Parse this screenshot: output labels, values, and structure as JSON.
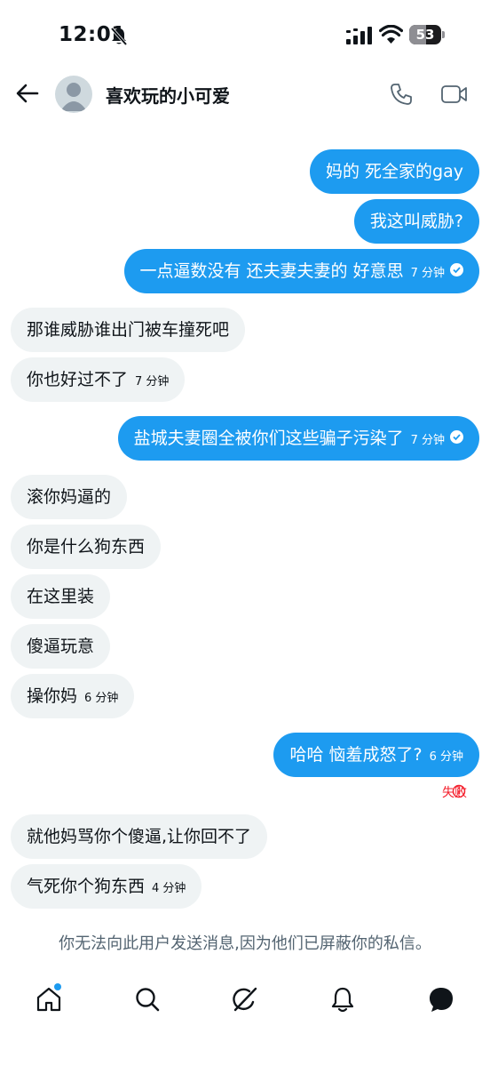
{
  "status_bar": {
    "time": "12:01",
    "battery": "53",
    "battery_level": 0.53,
    "icons": [
      "bell-off-icon",
      "signal-icon",
      "wifi-icon",
      "battery-icon"
    ]
  },
  "header": {
    "title": "喜欢玩的小可爱",
    "icons": [
      "back-arrow-icon",
      "avatar",
      "phone-icon",
      "video-icon"
    ]
  },
  "messages": [
    {
      "text": "妈的 死全家的gay",
      "time": "",
      "direction": "outgoing"
    },
    {
      "text": "我这叫威胁?",
      "time": "",
      "direction": "outgoing"
    },
    {
      "text": "一点逼数没有 还夫妻夫妻的 好意思",
      "time": "7 分钟",
      "direction": "outgoing",
      "status": "sent"
    },
    {
      "text": "那谁威胁谁出门被车撞死吧",
      "time": "",
      "direction": "incoming"
    },
    {
      "text": "你也好过不了",
      "time": "7 分钟",
      "direction": "incoming"
    },
    {
      "text": "盐城夫妻圈全被你们这些骗子污染了",
      "time": "7 分钟",
      "direction": "outgoing",
      "status": "sent"
    },
    {
      "text": "滚你妈逼的",
      "time": "",
      "direction": "incoming"
    },
    {
      "text": "你是什么狗东西",
      "time": "",
      "direction": "incoming"
    },
    {
      "text": "在这里装",
      "time": "",
      "direction": "incoming"
    },
    {
      "text": "傻逼玩意",
      "time": "",
      "direction": "incoming"
    },
    {
      "text": "操你妈",
      "time": "6 分钟",
      "direction": "incoming"
    },
    {
      "text": "哈哈 恼羞成怒了?",
      "time": "6 分钟",
      "direction": "outgoing",
      "status": "failed"
    },
    {
      "text": "就他妈骂你个傻逼,让你回不了",
      "time": "",
      "direction": "incoming"
    },
    {
      "text": "气死你个狗东西",
      "time": "4 分钟",
      "direction": "incoming"
    }
  ],
  "failed_label": "失败",
  "blocked_notice": "你无法向此用户发送消息,因为他们已屏蔽你的私信。",
  "colors": {
    "accent": "#1d9bf0",
    "incoming_bubble": "#eff3f4",
    "error": "#f4212e",
    "muted_text": "#536471"
  },
  "bottom_nav": {
    "items": [
      "home-icon",
      "search-icon",
      "grok-icon",
      "notifications-icon",
      "messages-icon"
    ],
    "active": "messages-icon"
  }
}
